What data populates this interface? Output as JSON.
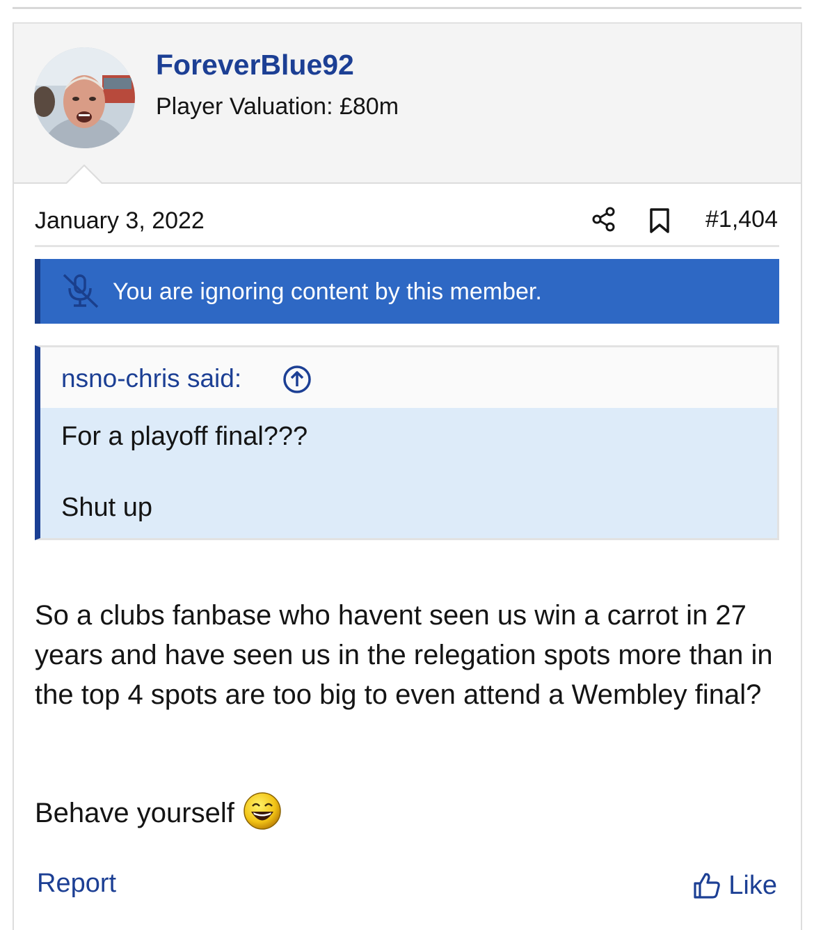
{
  "post": {
    "username": "ForeverBlue92",
    "user_title": "Player Valuation: £80m",
    "date": "January 3, 2022",
    "post_number": "#1,404",
    "ignore_notice": "You are ignoring content by this member.",
    "quote": {
      "author": "nsno-chris said:",
      "lines": [
        "For a playoff final???",
        "Shut up"
      ]
    },
    "body": {
      "paragraph_1": "So a clubs fanbase who havent seen us win a carrot in 27 years and have seen us in the relegation spots more than in the top 4 spots are too big to even attend a Wembley final?",
      "paragraph_2": "Behave yourself"
    },
    "actions": {
      "report": "Report",
      "like": "Like"
    }
  },
  "colors": {
    "link_blue": "#1c3f94",
    "banner_blue": "#2e68c4",
    "quote_bg": "#ddebf9"
  },
  "icons": {
    "share": "share-icon",
    "bookmark": "bookmark-icon",
    "ignore": "microphone-slash-icon",
    "quote_jump": "arrow-up-circle-icon",
    "like": "thumbs-up-icon",
    "emoji": "laughing-emoji-icon"
  }
}
